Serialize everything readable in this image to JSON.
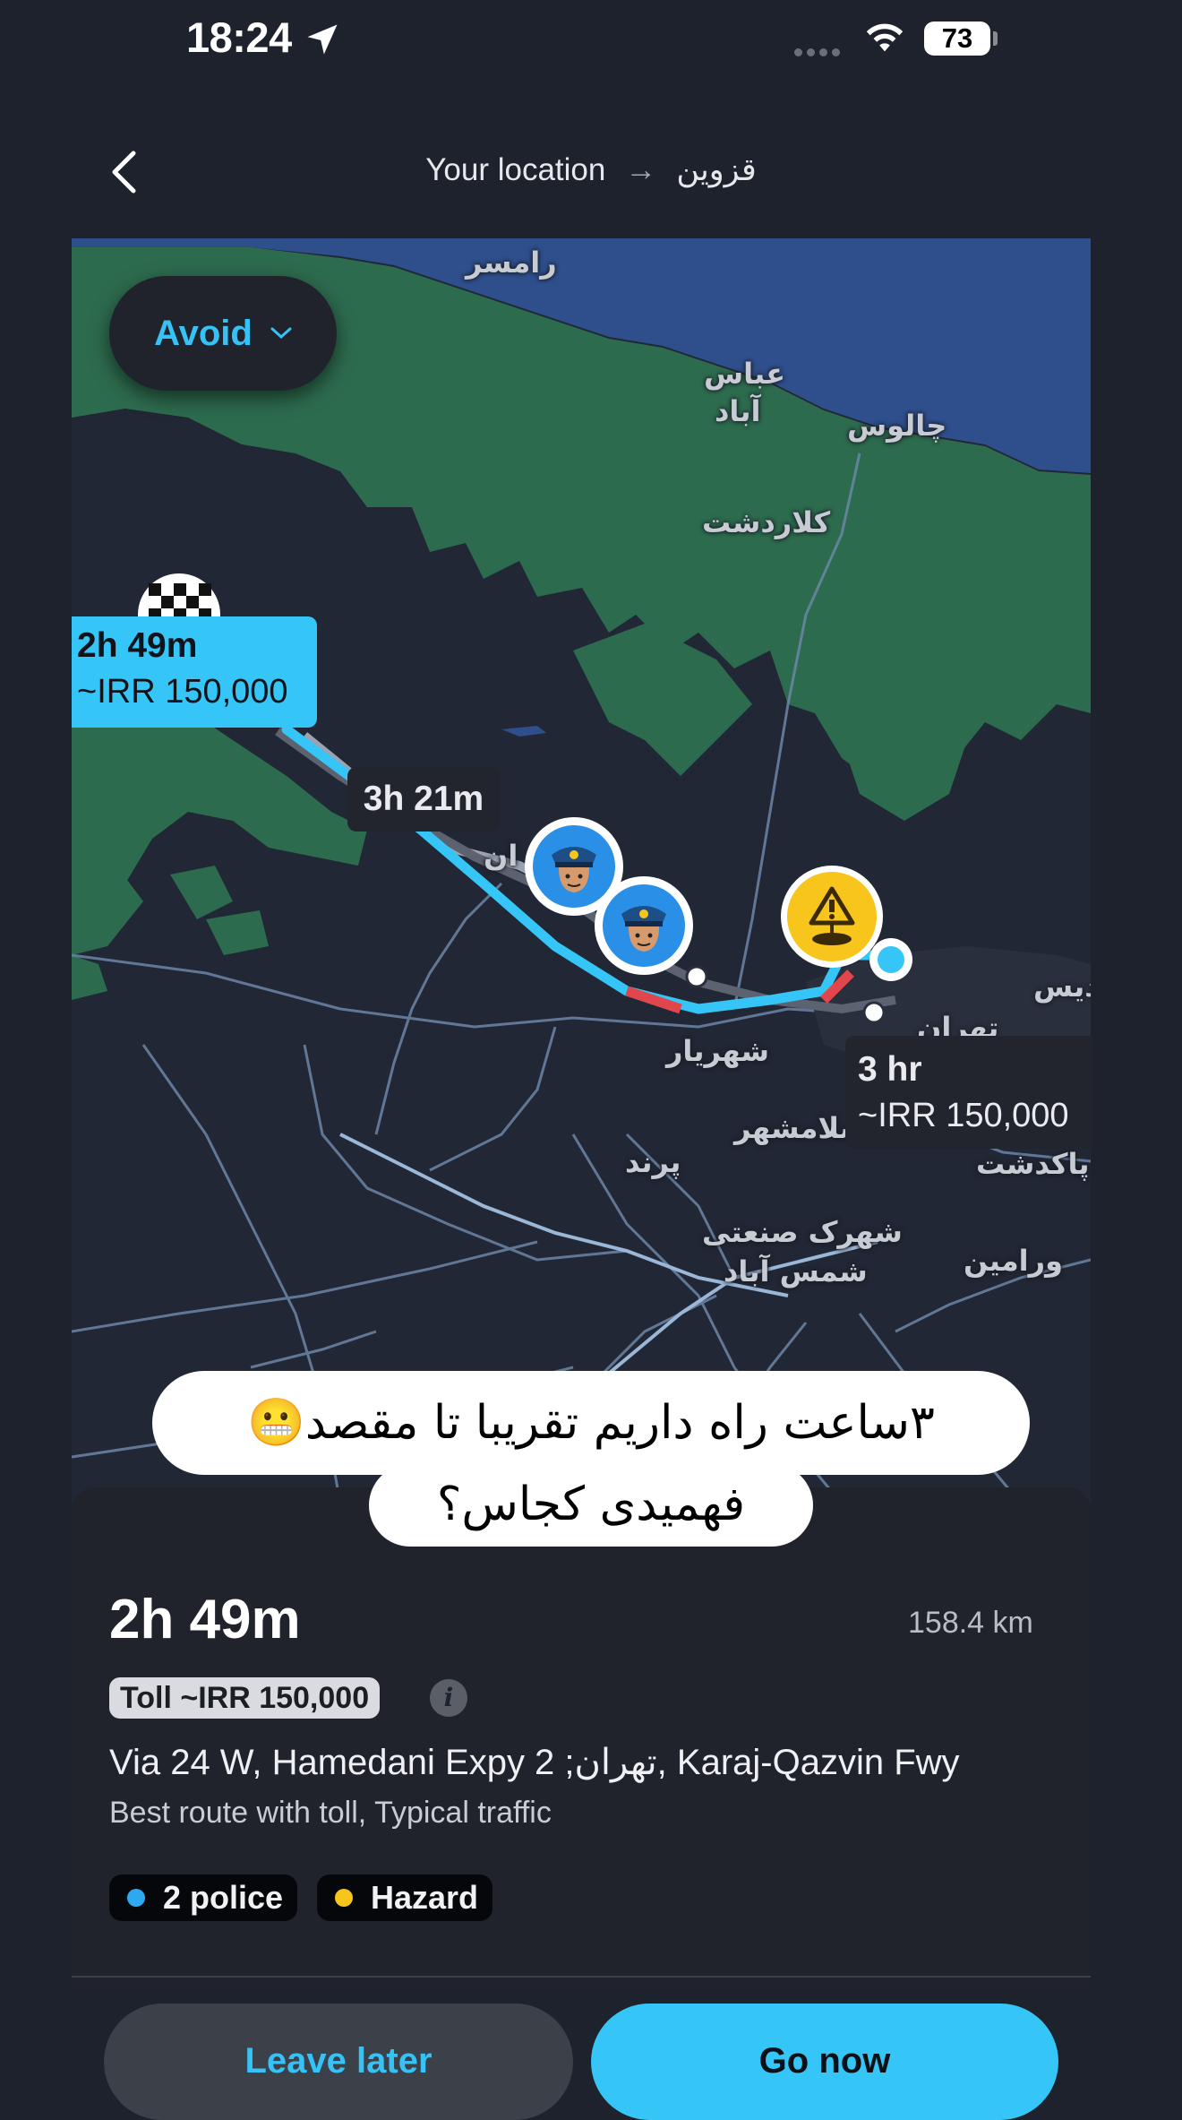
{
  "status_bar": {
    "time": "18:24",
    "battery": "73"
  },
  "header": {
    "origin": "Your location",
    "destination": "قزوین"
  },
  "map": {
    "avoid_label": "Avoid",
    "cities": {
      "ramsar": "رامسر",
      "abbasabad_1": "عباس",
      "abbasabad_2": "آباد",
      "chalus": "چالوس",
      "kelardasht": "کلاردشت",
      "shahriar": "شهریار",
      "eslamshahr": "اسلامشهر",
      "parand": "پرند",
      "shahrak_1": "شهرک صنعتی",
      "shahrak_2": "شمس آباد",
      "varamin": "ورامین",
      "pakdasht": "پاکدشت",
      "tehran": "تهران",
      "pardis_1": "پردیس",
      "karaj_partial": "ان"
    },
    "primary_route": {
      "duration": "2h 49m",
      "toll": "~IRR 150,000"
    },
    "alt_route_1": {
      "duration": "3h 21m"
    },
    "alt_route_2": {
      "duration": "3 hr",
      "toll": "~IRR 150,000"
    },
    "alert_icons": [
      "police-icon",
      "police-icon",
      "hazard-icon"
    ]
  },
  "overlay_caption": {
    "line1": "۳ساعت راه داریم تقریبا تا مقصد😬",
    "line2": "فهمیدی کجاس؟"
  },
  "route_sheet": {
    "duration": "2h 49m",
    "distance": "158.4 km",
    "toll_badge": "Toll ~IRR 150,000",
    "via": "Via 24 W, Hamedani Expy 2 ;تهران, Karaj-Qazvin Fwy",
    "subtitle": "Best route with toll, Typical traffic",
    "chips": [
      {
        "label": "2 police",
        "color": "#2ea8f0"
      },
      {
        "label": "Hazard",
        "color": "#f7c51b"
      }
    ]
  },
  "actions": {
    "leave_later": "Leave later",
    "go_now": "Go now"
  },
  "colors": {
    "accent": "#36c5f7",
    "background": "#1e222c",
    "forest": "#2d6b4e",
    "sea": "#2e4f8c"
  }
}
